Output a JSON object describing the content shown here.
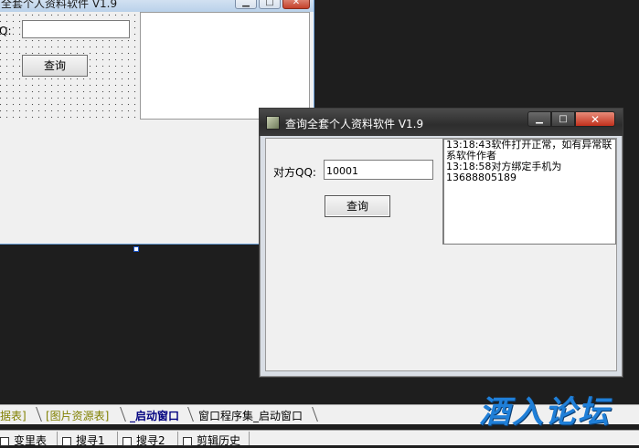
{
  "designer": {
    "title": "全套个人资料软件 V1.9",
    "qq_label": "Q:",
    "query_button": "查询"
  },
  "app": {
    "title": "查询全套个人资料软件 V1.9",
    "qq_label": "对方QQ:",
    "qq_value": "10001",
    "query_button": "查询",
    "log_lines": [
      "13:18:43软件打开正常，如有异常联系软件作者",
      "13:18:58对方绑定手机为13688805189"
    ]
  },
  "window_controls": {
    "minimize": "▁",
    "maximize": "□",
    "close": "✕"
  },
  "tabs": [
    {
      "label": "据表]",
      "style": "olive"
    },
    {
      "label": "[图片资源表]",
      "style": "olive"
    },
    {
      "label": "_启动窗口",
      "style": "active"
    },
    {
      "label": "窗口程序集_启动窗口",
      "style": "normal"
    }
  ],
  "status_items": [
    "变里表",
    "搜寻1",
    "搜寻2",
    "剪辑历史"
  ],
  "watermark": "酒入论坛"
}
